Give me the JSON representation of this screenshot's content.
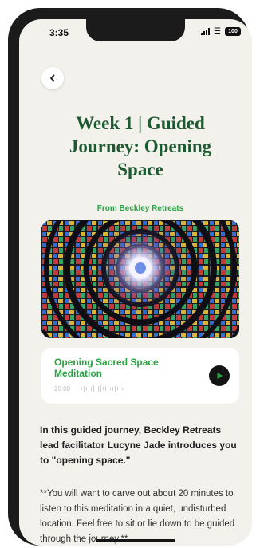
{
  "status_bar": {
    "time": "3:35",
    "battery": "100"
  },
  "nav": {
    "back_icon": "chevron-left-icon"
  },
  "page": {
    "title": "Week 1 | Guided Journey: Opening Space",
    "source": "From Beckley Retreats"
  },
  "audio": {
    "title": "Opening Sacred Space Meditation",
    "duration": "20:00",
    "play_icon": "play-icon"
  },
  "body": {
    "intro": "In this guided journey, Beckley Retreats lead facilitator Lucyne Jade introduces you to \"opening space.\"",
    "note": "**You will want to carve out about 20 minutes to listen to this meditation in a quiet, undisturbed location. Feel free to sit or lie down to be guided through the journey.**"
  },
  "colors": {
    "title_green": "#1e5a31",
    "accent_green": "#2aa342",
    "background": "#f2f1ec",
    "card": "#ffffff"
  }
}
